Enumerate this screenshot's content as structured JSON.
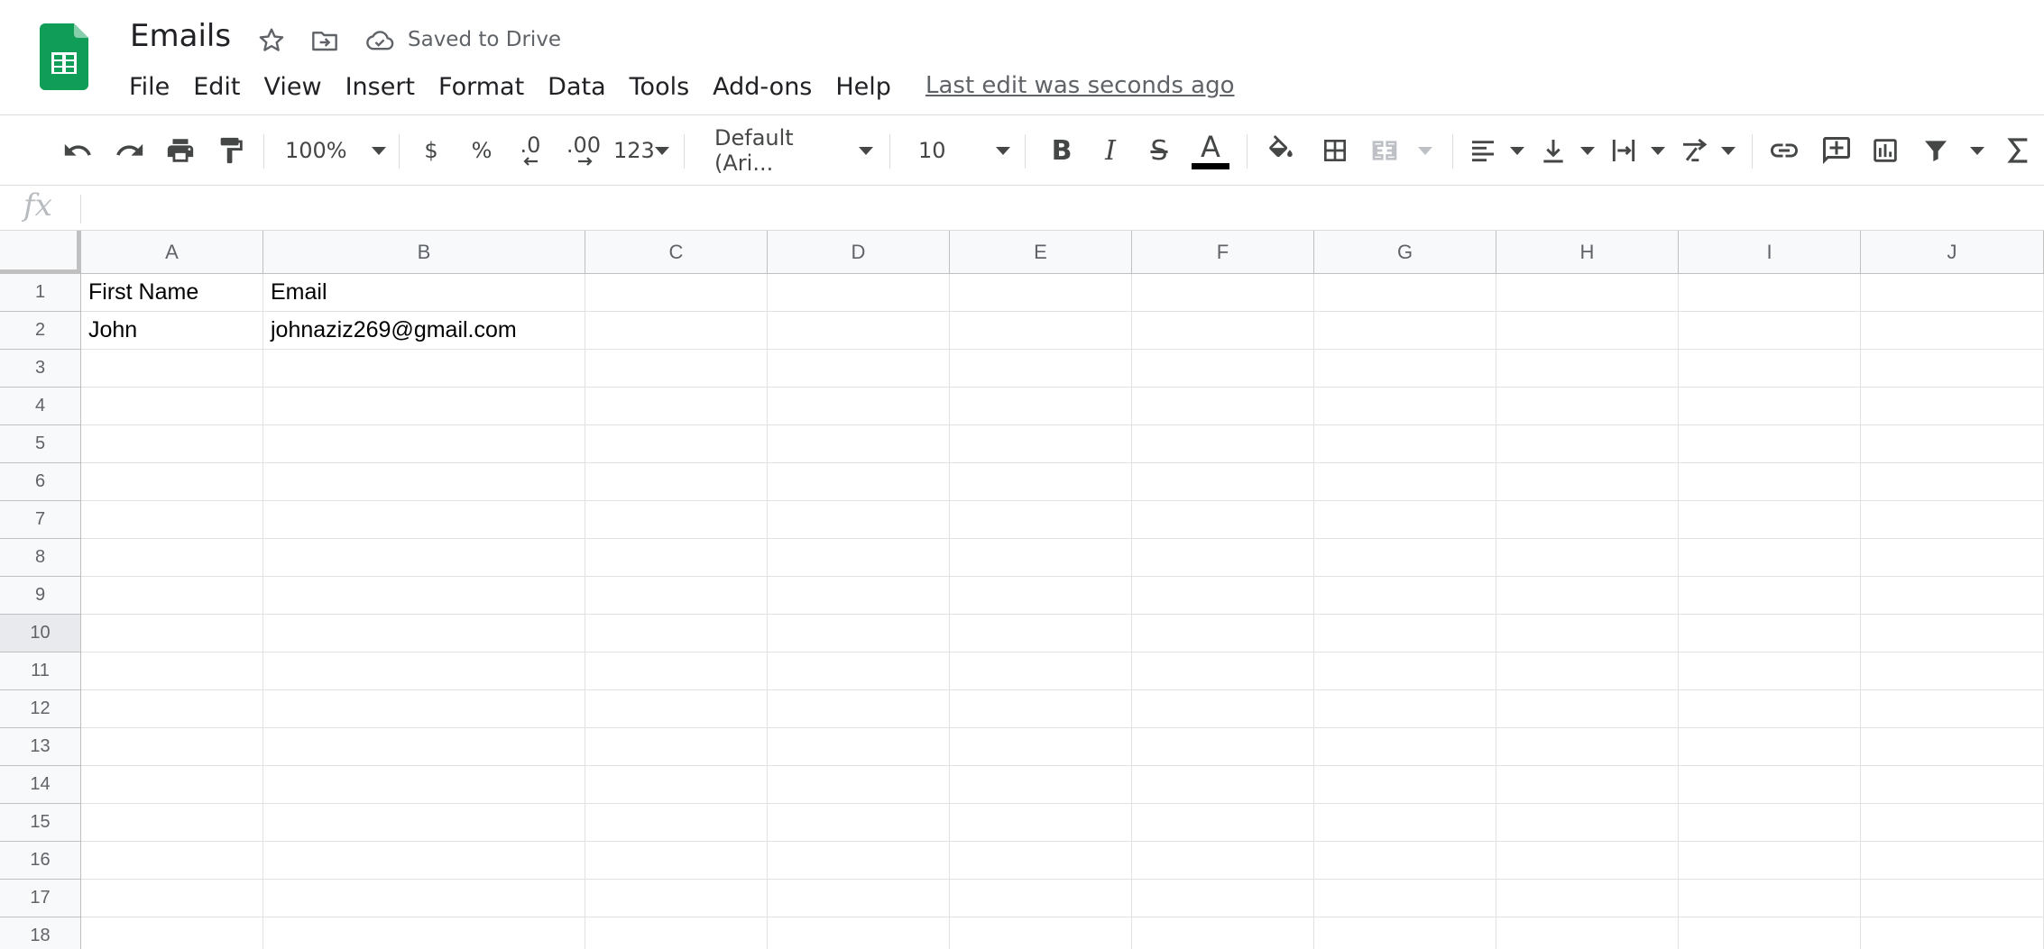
{
  "document": {
    "title": "Emails",
    "status": "Saved to Drive",
    "last_edit": "Last edit was seconds ago"
  },
  "menu": [
    "File",
    "Edit",
    "View",
    "Insert",
    "Format",
    "Data",
    "Tools",
    "Add-ons",
    "Help"
  ],
  "toolbar": {
    "zoom": "100%",
    "currency": "$",
    "percent": "%",
    "decrease_decimal": ".0",
    "increase_decimal": ".00",
    "more_formats": "123",
    "font": "Default (Ari...",
    "font_size": "10",
    "bold": "B",
    "italic": "I",
    "strikethrough": "S",
    "text_color_letter": "A",
    "text_color": "#000000"
  },
  "formula_bar": {
    "label": "fx",
    "value": ""
  },
  "sheet": {
    "columns": [
      "A",
      "B",
      "C",
      "D",
      "E",
      "F",
      "G",
      "H",
      "I",
      "J"
    ],
    "rows": [
      "1",
      "2",
      "3",
      "4",
      "5",
      "6",
      "7",
      "8",
      "9",
      "10",
      "11",
      "12",
      "13",
      "14",
      "15",
      "16",
      "17",
      "18"
    ],
    "selected_row": "10",
    "cells": [
      [
        "First Name",
        "Email"
      ],
      [
        "John",
        "johnaziz269@gmail.com"
      ]
    ]
  },
  "colors": {
    "brand_green": "#0f9d58",
    "grid_line": "#e2e2e2",
    "header_bg": "#f8f9fa"
  }
}
